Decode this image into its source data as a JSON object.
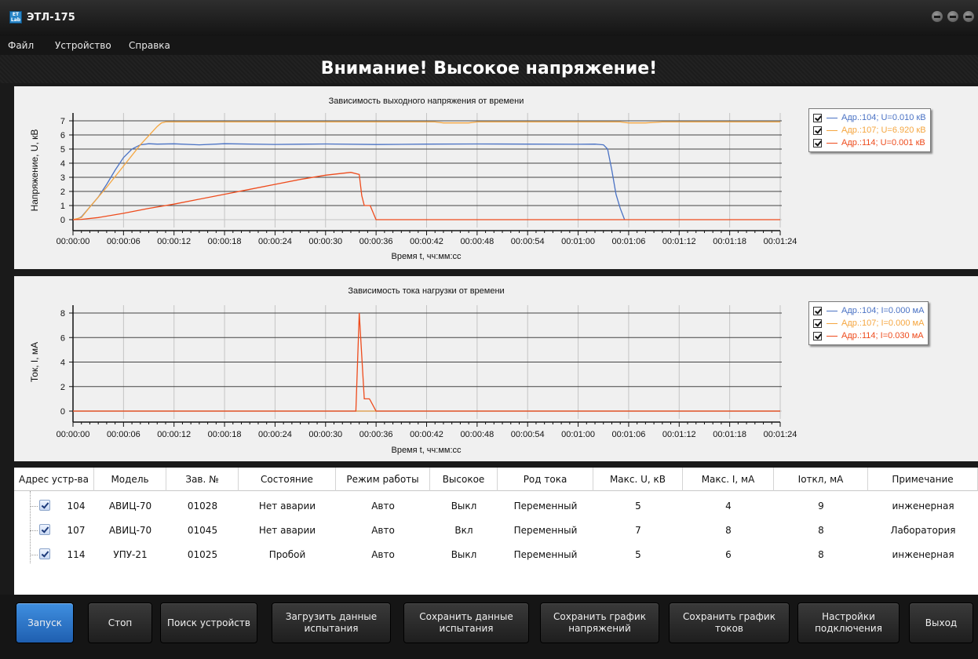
{
  "window": {
    "title": "ЭТЛ-175",
    "icon_text": "ET Lab"
  },
  "menu": [
    "Файл",
    "Устройство",
    "Справка"
  ],
  "warning": "Внимание! Высокое напряжение!",
  "colors": {
    "blue": "#4a72c4",
    "orange": "#f5a640",
    "red": "#ee4b1c",
    "accent": "#2f78d0"
  },
  "x_ticks": [
    "00:00:00",
    "00:00:06",
    "00:00:12",
    "00:00:18",
    "00:00:24",
    "00:00:30",
    "00:00:36",
    "00:00:42",
    "00:00:48",
    "00:00:54",
    "00:01:00",
    "00:01:06",
    "00:01:12",
    "00:01:18",
    "00:01:24"
  ],
  "chart_data": [
    {
      "type": "line",
      "title": "Зависимость выходного напряжения от времени",
      "xlabel": "Время t, чч:мм:сс",
      "ylabel": "Напряжение, U, кВ",
      "xlim": [
        0,
        84
      ],
      "ylim": [
        0,
        7
      ],
      "y_ticks": [
        0,
        1,
        2,
        3,
        4,
        5,
        6,
        7
      ],
      "grid": true,
      "legend_position": "right",
      "series": [
        {
          "name": "Адр.:104; U=0.010 кВ",
          "color": "#4a72c4",
          "x": [
            0,
            0.5,
            1,
            2,
            3,
            4,
            5,
            6,
            7,
            8,
            9,
            10,
            12,
            15,
            18,
            24,
            30,
            36,
            42,
            48,
            54,
            60,
            62,
            63,
            63.5,
            64,
            64.5,
            65,
            65.5
          ],
          "y": [
            0,
            0.05,
            0.2,
            0.9,
            1.6,
            2.5,
            3.5,
            4.4,
            5.0,
            5.3,
            5.38,
            5.35,
            5.37,
            5.3,
            5.38,
            5.33,
            5.36,
            5.32,
            5.35,
            5.36,
            5.35,
            5.34,
            5.35,
            5.3,
            5.0,
            3.5,
            1.8,
            0.8,
            0.02
          ]
        },
        {
          "name": "Адр.:107; U=6.920 кВ",
          "color": "#f5a640",
          "x": [
            0,
            1,
            2,
            4,
            6,
            8,
            10,
            10.5,
            11,
            20,
            30,
            40,
            43,
            44,
            47,
            48,
            60,
            65,
            66,
            68,
            70,
            84
          ],
          "y": [
            0,
            0.15,
            0.9,
            2.3,
            3.8,
            5.3,
            6.6,
            6.85,
            6.92,
            6.92,
            6.92,
            6.92,
            6.92,
            6.85,
            6.85,
            6.92,
            6.92,
            6.92,
            6.85,
            6.85,
            6.92,
            6.92
          ]
        },
        {
          "name": "Адр.:114; U=0.001 кВ",
          "color": "#ee4b1c",
          "x": [
            0,
            1,
            3,
            6,
            9,
            12,
            15,
            18,
            21,
            24,
            27,
            30,
            33,
            34,
            34.3,
            34.6,
            35.3,
            36,
            84
          ],
          "y": [
            0,
            0.02,
            0.15,
            0.45,
            0.8,
            1.1,
            1.45,
            1.8,
            2.15,
            2.5,
            2.85,
            3.15,
            3.35,
            3.2,
            1.7,
            1.0,
            1.0,
            0,
            0
          ]
        }
      ]
    },
    {
      "type": "line",
      "title": "Зависимость тока нагрузки от времени",
      "xlabel": "Время t, чч:мм:сс",
      "ylabel": "Ток, I, мА",
      "xlim": [
        0,
        84
      ],
      "ylim": [
        0,
        8
      ],
      "y_ticks": [
        0,
        2,
        4,
        6,
        8
      ],
      "grid": true,
      "legend_position": "right",
      "series": [
        {
          "name": "Адр.:104; I=0.000 мА",
          "color": "#4a72c4",
          "x": [
            0,
            84
          ],
          "y": [
            0,
            0
          ]
        },
        {
          "name": "Адр.:107; I=0.000 мА",
          "color": "#f5a640",
          "x": [
            0,
            84
          ],
          "y": [
            0,
            0
          ]
        },
        {
          "name": "Адр.:114; I=0.030 мА",
          "color": "#ee4b1c",
          "x": [
            0,
            33,
            33.6,
            34,
            34.6,
            35.2,
            35.3,
            36,
            84
          ],
          "y": [
            0,
            0,
            0,
            8,
            1,
            1,
            0.9,
            0,
            0
          ]
        }
      ]
    }
  ],
  "table": {
    "headers": [
      "Адрес устр-ва",
      "Модель",
      "Зав. №",
      "Состояние",
      "Режим работы",
      "Высокое",
      "Род тока",
      "Макс. U, кВ",
      "Макс. I, мА",
      "Iоткл, мА",
      "Примечание"
    ],
    "rows": [
      [
        "104",
        "АВИЦ-70",
        "01028",
        "Нет аварии",
        "Авто",
        "Выкл",
        "Переменный",
        "5",
        "4",
        "9",
        "инженерная"
      ],
      [
        "107",
        "АВИЦ-70",
        "01045",
        "Нет аварии",
        "Авто",
        "Вкл",
        "Переменный",
        "7",
        "8",
        "8",
        "Лаборатория"
      ],
      [
        "114",
        "УПУ-21",
        "01025",
        "Пробой",
        "Авто",
        "Выкл",
        "Переменный",
        "5",
        "6",
        "8",
        "инженерная"
      ]
    ]
  },
  "buttons": [
    {
      "label": "Запуск",
      "active": true
    },
    {
      "label": "Стоп"
    },
    {
      "label": "Поиск устройств"
    },
    {
      "label": "Загрузить данные испытания"
    },
    {
      "label": "Сохранить данные испытания"
    },
    {
      "label": "Сохранить график напряжений"
    },
    {
      "label": "Сохранить график токов"
    },
    {
      "label": "Настройки подключения"
    },
    {
      "label": "Выход"
    }
  ]
}
